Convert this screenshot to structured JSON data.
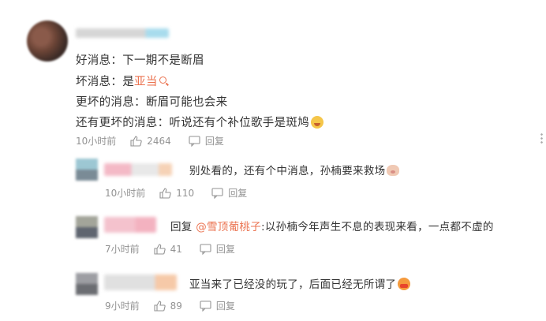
{
  "main_comment": {
    "lines": [
      {
        "label": "好消息：",
        "text": "下一期不是断眉"
      },
      {
        "label": "坏消息：",
        "text": "是",
        "link": "亚当"
      },
      {
        "label": "更坏的消息：",
        "text": "断眉可能也会来"
      },
      {
        "label": "还有更坏的消息：",
        "text": "听说还有个补位歌手是斑鸠"
      }
    ],
    "time": "10小时前",
    "likes": "2464",
    "reply_label": "回复"
  },
  "replies": [
    {
      "text": "别处看的，还有个中消息，孙楠要来救场",
      "emoji": "pig-emoji",
      "time": "10小时前",
      "likes": "110",
      "reply_label": "回复"
    },
    {
      "prefix": "回复 ",
      "mention": "@雪顶葡桃子",
      "text": ":以孙楠今年声生不息的表现来看，一点都不虚的",
      "time": "7小时前",
      "likes": "41",
      "reply_label": "回复"
    },
    {
      "text": "亚当来了已经没的玩了，后面已经无所谓了",
      "emoji": "crying-emoji",
      "time": "9小时前",
      "likes": "89",
      "reply_label": "回复"
    }
  ],
  "colors": {
    "link": "#eb7350",
    "meta": "#939393",
    "text": "#333333"
  }
}
